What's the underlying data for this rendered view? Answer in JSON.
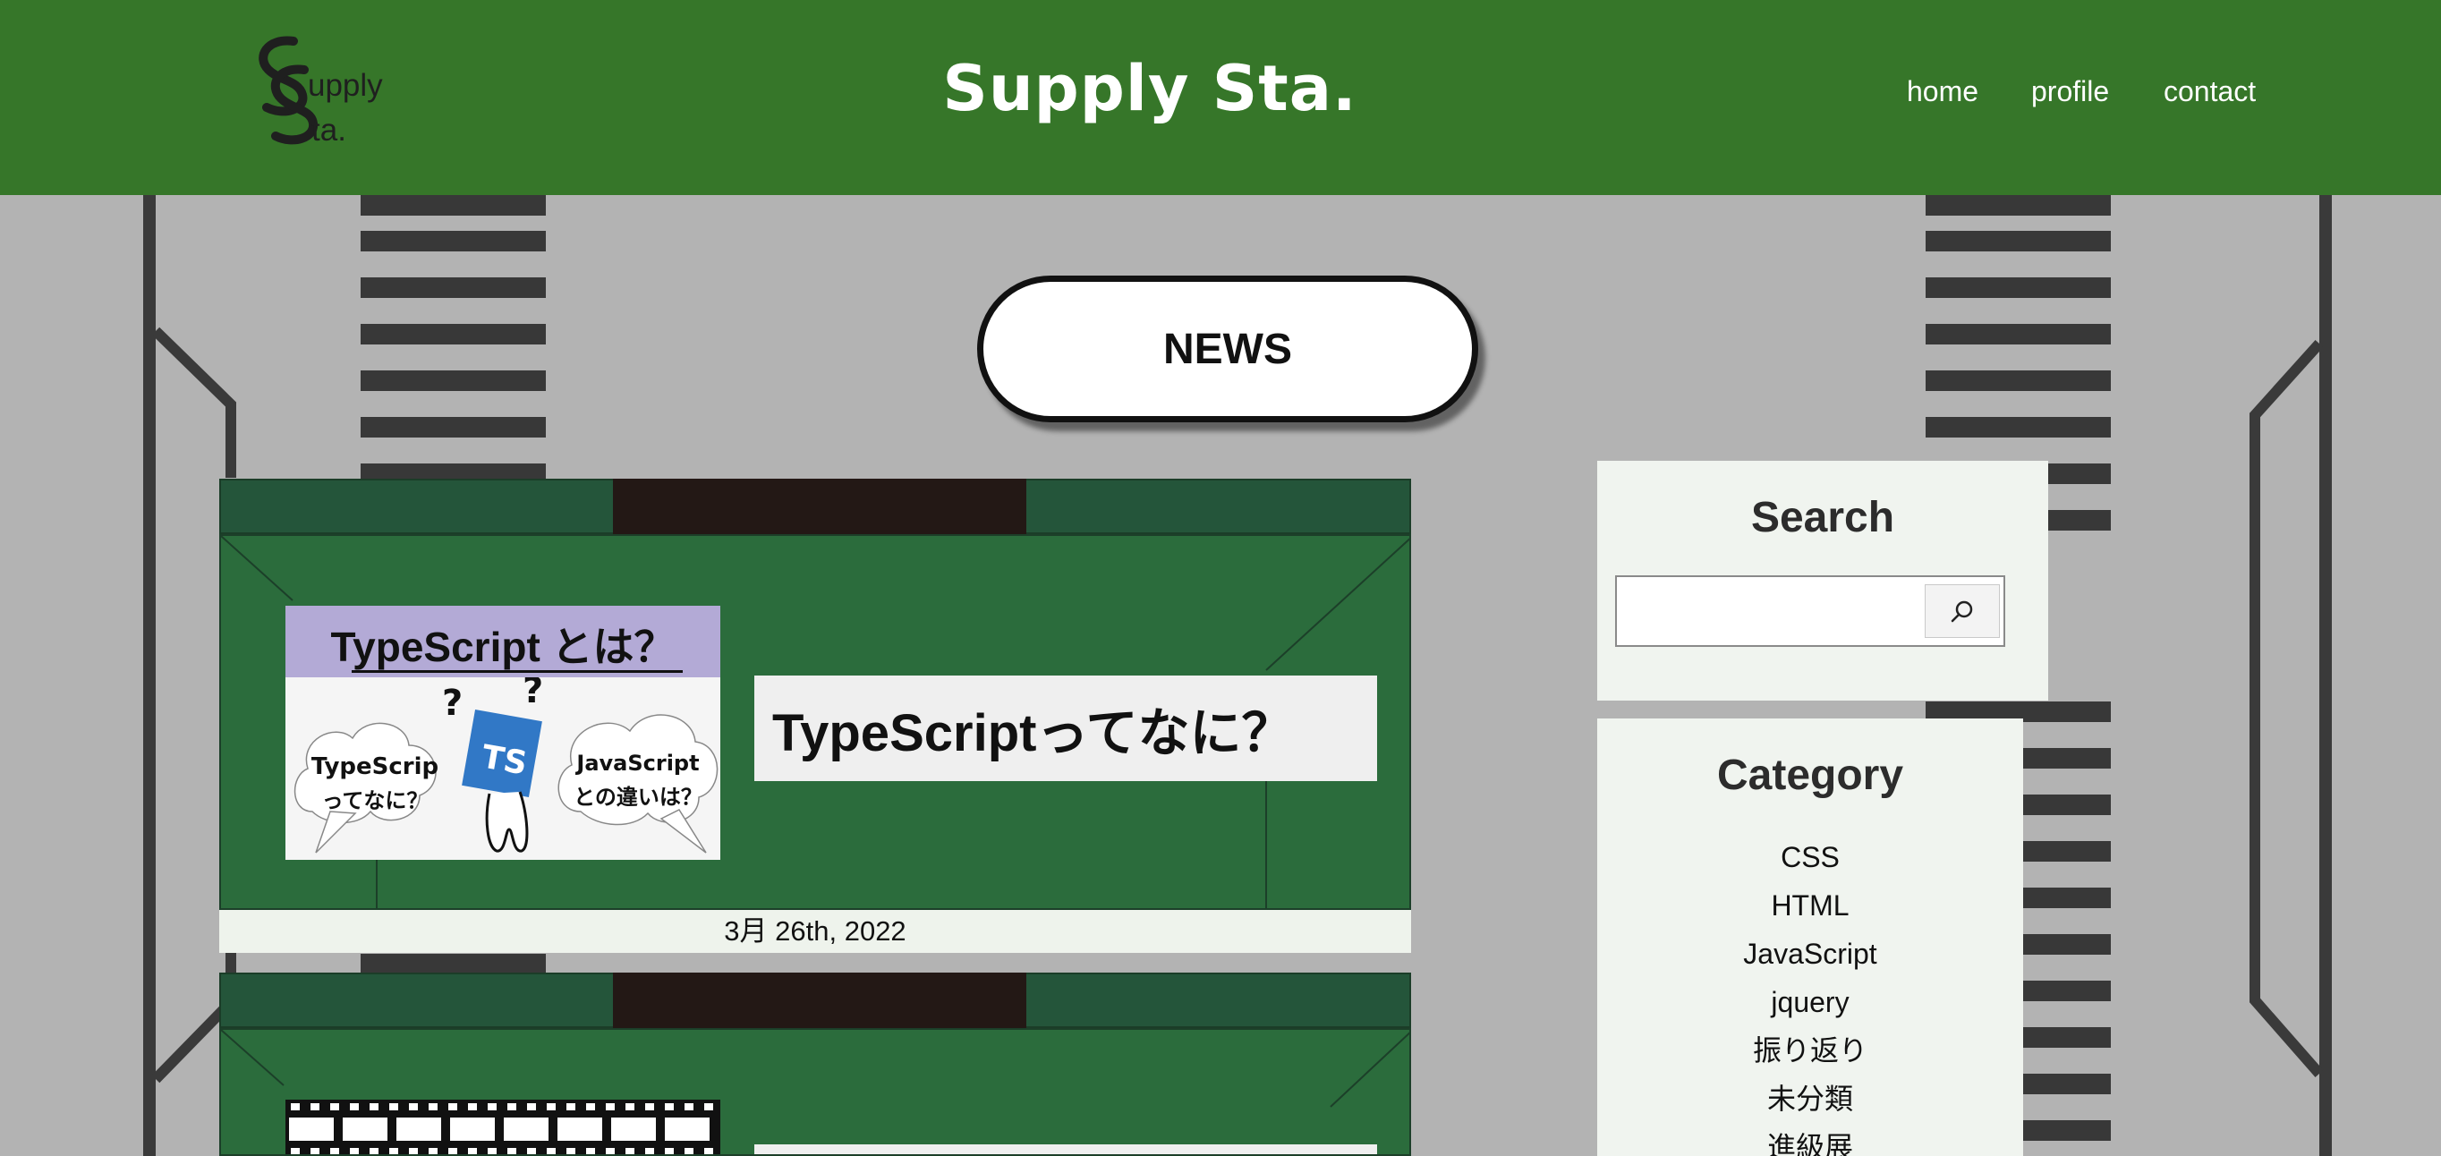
{
  "header": {
    "logo_line1": "upply",
    "logo_line2": "ta.",
    "site_title": "Supply Sta.",
    "nav": [
      {
        "label": "home"
      },
      {
        "label": "profile"
      },
      {
        "label": "contact"
      }
    ],
    "bg_color": "#367629"
  },
  "news_heading": "NEWS",
  "posts": [
    {
      "thumb_title": "TypeScript とは？",
      "bubble_left": "TypeScrip\nってなに？",
      "bubble_right": "JavaScript\nとの違いは？",
      "badge": "TS",
      "title": "TypeScriptってなに？",
      "date": "3月 26th, 2022"
    },
    {
      "thumb_title": "",
      "title": "",
      "date": ""
    }
  ],
  "sidebar": {
    "search": {
      "title": "Search",
      "placeholder": "",
      "button_icon": "search-icon"
    },
    "category": {
      "title": "Category",
      "items": [
        "CSS",
        "HTML",
        "JavaScript",
        "jquery",
        "振り返り",
        "未分類",
        "進級展"
      ]
    }
  },
  "colors": {
    "header": "#367629",
    "road": "#b3b3b3",
    "card_green": "#2b6c3c",
    "badge_blue": "#3178c6"
  }
}
